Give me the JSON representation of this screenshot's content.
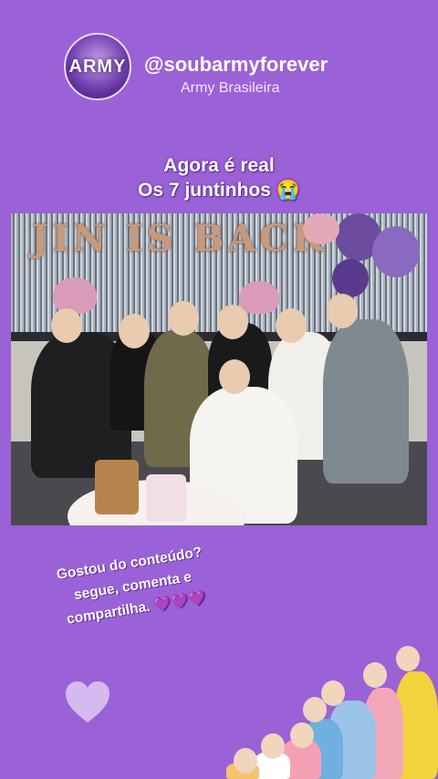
{
  "profile": {
    "avatar_label": "ARMY",
    "username": "@soubarmyforever",
    "subtitle": "Army Brasileira"
  },
  "headline": {
    "line1": "Agora é real",
    "line2": "Os 7 juntinhos 😭"
  },
  "photo": {
    "banner_text": "JIN IS BACK"
  },
  "cta": {
    "line1": "Gostou do conteúdo?",
    "line2": "segue, comenta e",
    "line3": "compartilha. 💜💜💜"
  },
  "colors": {
    "background": "#9a62d6",
    "accent": "#7a3fd0"
  },
  "icons": {
    "heart_sticker": "heart-icon"
  }
}
